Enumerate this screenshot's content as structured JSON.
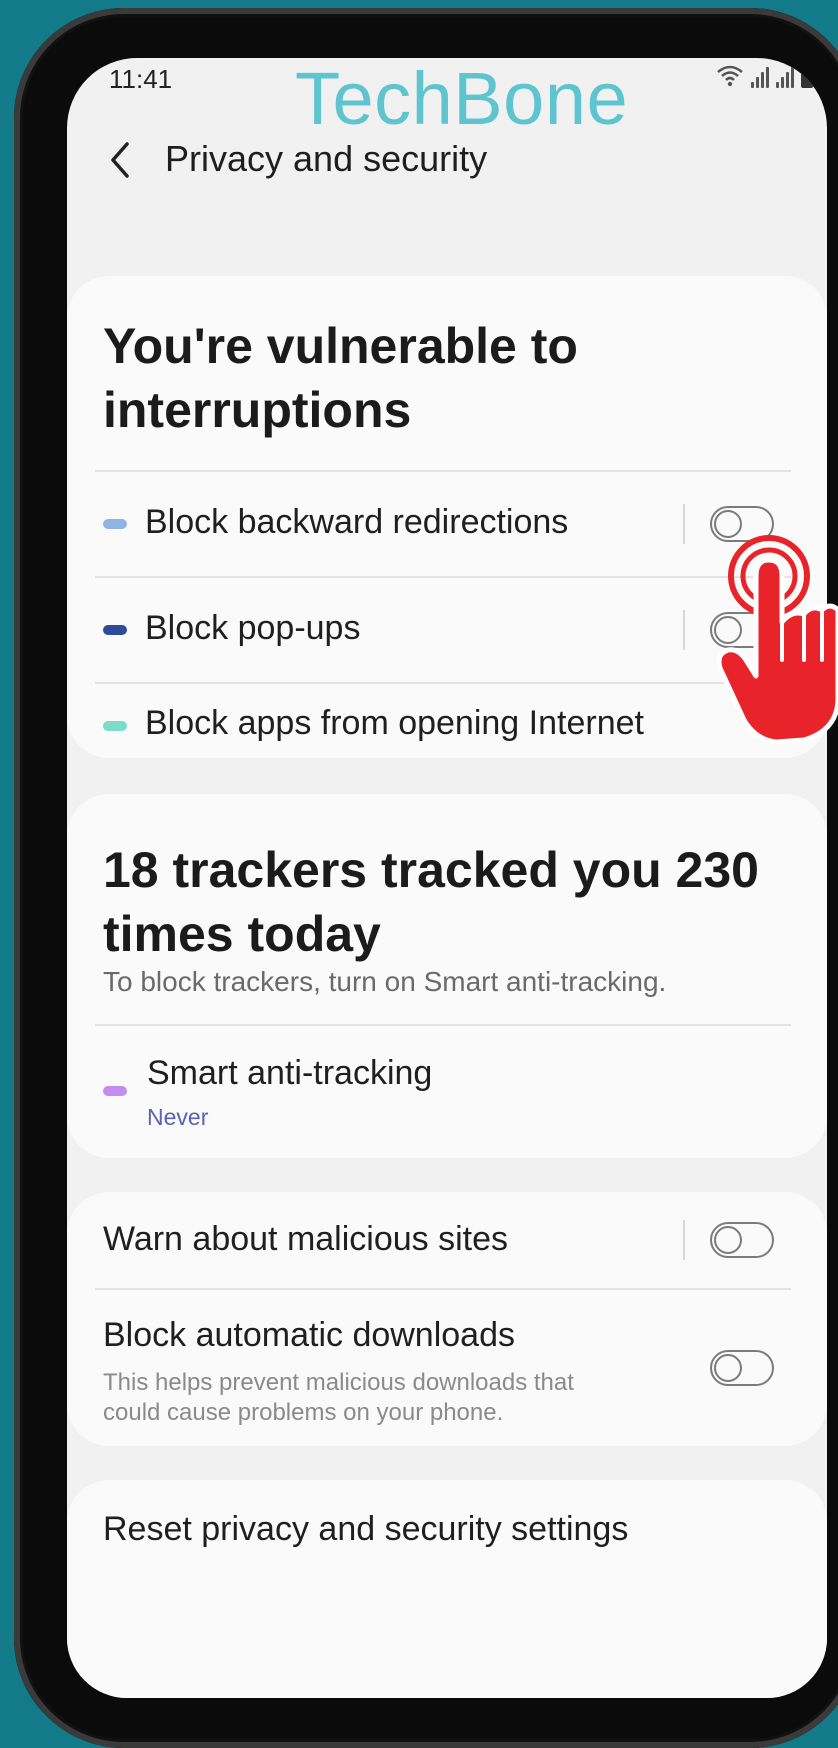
{
  "status_bar": {
    "time": "11:41",
    "icons": [
      "wifi-icon",
      "signal-icon",
      "signal-icon",
      "battery-icon"
    ]
  },
  "watermark": "TechBone",
  "app_bar": {
    "back_icon": "chevron-left-icon",
    "title": "Privacy and security"
  },
  "vulnerability_card": {
    "heading": "You're vulnerable to interruptions",
    "items": [
      {
        "label": "Block backward redirections",
        "dot_color": "#8fb3e3",
        "has_toggle": true,
        "enabled": false
      },
      {
        "label": "Block pop-ups",
        "dot_color": "#2d4b99",
        "has_toggle": true,
        "enabled": false
      },
      {
        "label": "Block apps from opening Internet",
        "dot_color": "#7cdbc9",
        "has_toggle": false
      }
    ]
  },
  "tracker_card": {
    "heading": "18 trackers tracked you 230 times today",
    "subtitle": "To block trackers, turn on Smart anti-tracking.",
    "item": {
      "label": "Smart anti-tracking",
      "value": "Never",
      "dot_color": "#c48df0"
    }
  },
  "security_card": {
    "items": [
      {
        "label": "Warn about malicious sites",
        "enabled": false
      },
      {
        "label": "Block automatic downloads",
        "description": "This helps prevent malicious downloads that could cause problems on your phone.",
        "enabled": false
      }
    ]
  },
  "reset_card": {
    "label": "Reset privacy and security settings"
  },
  "overlay": {
    "icon": "tap-hand-icon",
    "color": "#e8232a"
  }
}
